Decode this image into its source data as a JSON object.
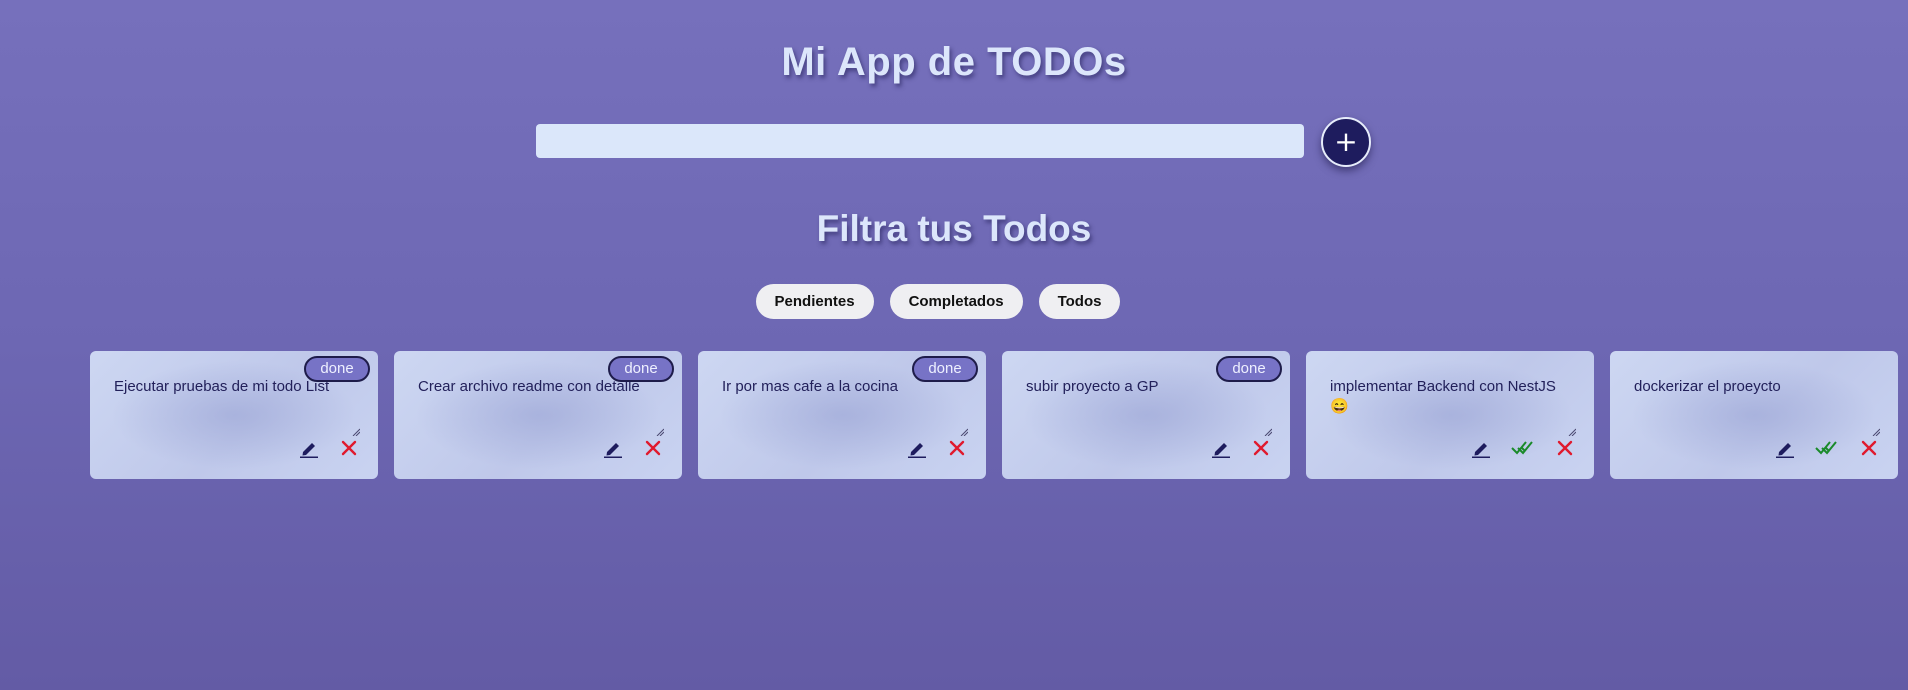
{
  "app": {
    "title": "Mi App de TODOs"
  },
  "new_todo": {
    "value": "",
    "placeholder": "",
    "add_label": "+"
  },
  "filters": {
    "title": "Filtra tus Todos",
    "buttons": [
      "Pendientes",
      "Completados",
      "Todos"
    ]
  },
  "todos": [
    {
      "text": "Ejecutar pruebas de mi todo List",
      "done": true,
      "badge": "done"
    },
    {
      "text": "Crear archivo readme con detalle",
      "done": true,
      "badge": "done"
    },
    {
      "text": "Ir por mas cafe a la cocina",
      "done": true,
      "badge": "done"
    },
    {
      "text": "subir proyecto a GP",
      "done": true,
      "badge": "done"
    },
    {
      "text": "implementar Backend con NestJS 😄",
      "done": false,
      "badge": ""
    },
    {
      "text": "dockerizar el proeycto",
      "done": false,
      "badge": ""
    }
  ],
  "colors": {
    "accent": "#1e1c5e",
    "badge": "#7773c6",
    "edit_icon": "#1e1c5e",
    "complete_icon": "#1a8a2a",
    "delete_icon": "#e0192d"
  },
  "icons": {
    "edit": "pencil-icon",
    "complete": "double-check-icon",
    "delete": "close-icon"
  }
}
